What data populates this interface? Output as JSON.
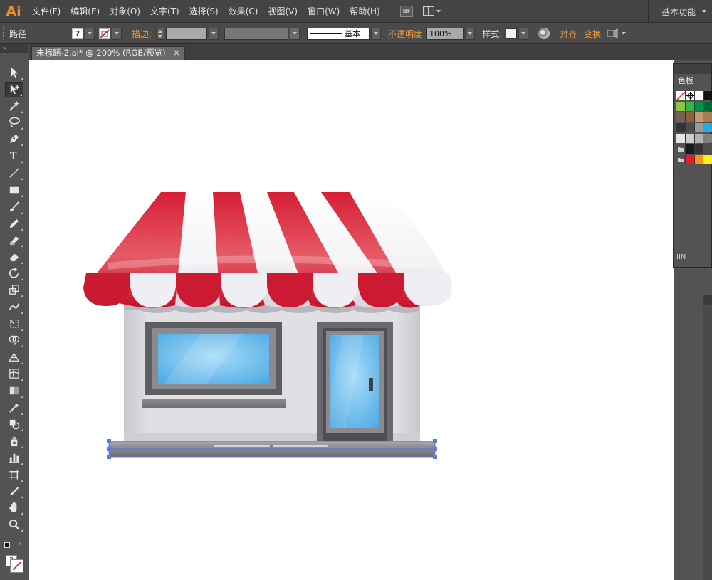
{
  "app": {
    "logo": "Ai"
  },
  "menu": [
    "文件(F)",
    "编辑(E)",
    "对象(O)",
    "文字(T)",
    "选择(S)",
    "效果(C)",
    "视图(V)",
    "窗口(W)",
    "帮助(H)"
  ],
  "bridge_button": "Br",
  "workspace": "基本功能",
  "control_bar": {
    "selection_type": "路径",
    "fill_icon": "unknown-fill-swatch",
    "stroke_icon": "none-stroke-swatch",
    "stroke_label": "描边:",
    "stroke_profile": "基本",
    "opacity_label": "不透明度",
    "opacity_value": "100%",
    "style_label": "样式:",
    "align_label": "对齐",
    "transform_label": "变换"
  },
  "document_tab": {
    "title": "未标题-2.ai* @ 200% (RGB/预览)",
    "close": "×"
  },
  "tools": [
    "selection-tool",
    "direct-selection-tool",
    "magic-wand-tool",
    "lasso-tool",
    "pen-tool",
    "type-tool",
    "line-segment-tool",
    "rectangle-tool",
    "paintbrush-tool",
    "pencil-tool",
    "blob-brush-tool",
    "eraser-tool",
    "rotate-tool",
    "scale-tool",
    "warp-tool",
    "free-transform-tool",
    "shape-builder-tool",
    "perspective-grid-tool",
    "mesh-tool",
    "gradient-tool",
    "eyedropper-tool",
    "blend-tool",
    "symbol-sprayer-tool",
    "column-graph-tool",
    "artboard-tool",
    "slice-tool",
    "hand-tool",
    "zoom-tool"
  ],
  "swatch_panel": {
    "title": "色板",
    "rows": [
      [
        "none",
        "registration",
        "#ffffff",
        "#111111"
      ],
      [
        "#8dc63f",
        "#39b54a",
        "#009245",
        "#006837"
      ],
      [
        "#736357",
        "#8c6239",
        "#c69c6d",
        "#a67c52"
      ],
      [
        "#333333",
        "#4d4d4d",
        "#999999",
        "#29abe2"
      ],
      [
        "#e6e6e6",
        "#cccccc",
        "#b3b3b3",
        "#808080"
      ],
      [
        "folder",
        "#1a1a1a",
        "#333333",
        "#4d4d4d"
      ],
      [
        "folder",
        "#ed1c24",
        "#f7931e",
        "#fcee21"
      ]
    ],
    "footer": "IIN"
  },
  "artwork": {
    "awning_colors": {
      "red": "#d71e35",
      "white": "#f3f2f5"
    },
    "wall_color": "#dddce1",
    "glass_color": "#5fb7ea",
    "frame_color": "#5e5e62"
  }
}
